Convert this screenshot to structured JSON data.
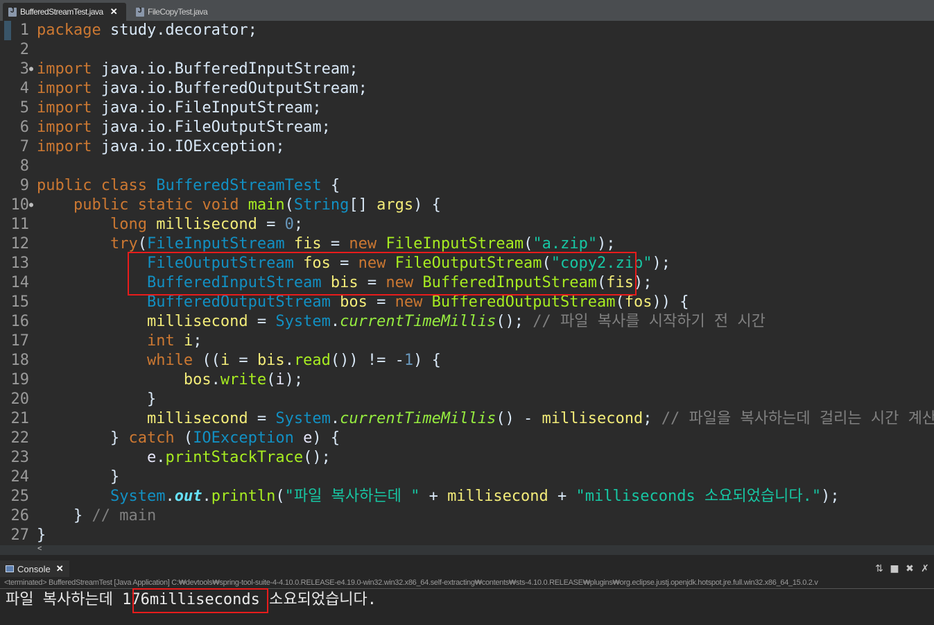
{
  "tabs": [
    {
      "label": "BufferedStreamTest.java",
      "active": true
    },
    {
      "label": "FileCopyTest.java",
      "active": false
    }
  ],
  "lines": [
    {
      "n": "1"
    },
    {
      "n": "2"
    },
    {
      "n": "3"
    },
    {
      "n": "4"
    },
    {
      "n": "5"
    },
    {
      "n": "6"
    },
    {
      "n": "7"
    },
    {
      "n": "8"
    },
    {
      "n": "9"
    },
    {
      "n": "10"
    },
    {
      "n": "11"
    },
    {
      "n": "12"
    },
    {
      "n": "13"
    },
    {
      "n": "14"
    },
    {
      "n": "15"
    },
    {
      "n": "16"
    },
    {
      "n": "17"
    },
    {
      "n": "18"
    },
    {
      "n": "19"
    },
    {
      "n": "20"
    },
    {
      "n": "21"
    },
    {
      "n": "22"
    },
    {
      "n": "23"
    },
    {
      "n": "24"
    },
    {
      "n": "25"
    },
    {
      "n": "26"
    },
    {
      "n": "27"
    }
  ],
  "code": {
    "l1": [
      "package",
      " study.decorator;"
    ],
    "l3": [
      "import",
      " java.io.BufferedInputStream;"
    ],
    "l4": [
      "import",
      " java.io.BufferedOutputStream;"
    ],
    "l5": [
      "import",
      " java.io.FileInputStream;"
    ],
    "l6": [
      "import",
      " java.io.FileOutputStream;"
    ],
    "l7": [
      "import",
      " java.io.IOException;"
    ],
    "l9": [
      "public",
      " class ",
      "BufferedStreamTest",
      " {"
    ],
    "l10": [
      "    ",
      "public",
      " ",
      "static",
      " ",
      "void",
      " ",
      "main",
      "(",
      "String",
      "[] ",
      "args",
      ") {"
    ],
    "l11": [
      "        ",
      "long",
      " ",
      "millisecond",
      " = ",
      "0",
      ";"
    ],
    "l12": [
      "        ",
      "try",
      "(",
      "FileInputStream",
      " ",
      "fis",
      " = ",
      "new",
      " ",
      "FileInputStream",
      "(",
      "\"a.zip\"",
      ");"
    ],
    "l13": [
      "            ",
      "FileOutputStream",
      " ",
      "fos",
      " = ",
      "new",
      " ",
      "FileOutputStream",
      "(",
      "\"copy2.zip\"",
      ");"
    ],
    "l14": [
      "            ",
      "BufferedInputStream",
      " ",
      "bis",
      " = ",
      "new",
      " ",
      "BufferedInputStream",
      "(",
      "fis",
      ");"
    ],
    "l15": [
      "            ",
      "BufferedOutputStream",
      " ",
      "bos",
      " = ",
      "new",
      " ",
      "BufferedOutputStream",
      "(",
      "fos",
      ")) {"
    ],
    "l16": [
      "            ",
      "millisecond",
      " = ",
      "System",
      ".",
      "currentTimeMillis",
      "(); ",
      "// 파일 복사를 시작하기 전 시간"
    ],
    "l17": [
      "            ",
      "int",
      " ",
      "i",
      ";"
    ],
    "l18": [
      "            ",
      "while",
      " ((",
      "i",
      " = ",
      "bis",
      ".",
      "read",
      "()) != -",
      "1",
      ") {"
    ],
    "l19": [
      "                ",
      "bos",
      ".",
      "write",
      "(",
      "i",
      ");"
    ],
    "l20": [
      "            }"
    ],
    "l21": [
      "            ",
      "millisecond",
      " = ",
      "System",
      ".",
      "currentTimeMillis",
      "() - ",
      "millisecond",
      "; ",
      "// 파일을 복사하는데 걸리는 시간 계산"
    ],
    "l22": [
      "        } ",
      "catch",
      " (",
      "IOException",
      " ",
      "e",
      ") {"
    ],
    "l23": [
      "            ",
      "e",
      ".",
      "printStackTrace",
      "();"
    ],
    "l24": [
      "        }"
    ],
    "l25": [
      "        ",
      "System",
      ".",
      "out",
      ".",
      "println",
      "(",
      "\"파일 복사하는데 \"",
      " + ",
      "millisecond",
      " + ",
      "\"milliseconds 소요되었습니다.\"",
      ");"
    ],
    "l26": [
      "    } ",
      "// main"
    ],
    "l27": [
      "}"
    ]
  },
  "console": {
    "tab_label": "Console",
    "terminated": "<terminated> BufferedStreamTest [Java Application] C:₩devtools₩spring-tool-suite-4-4.10.0.RELEASE-e4.19.0-win32.win32.x86_64.self-extracting₩contents₩sts-4.10.0.RELEASE₩plugins₩org.eclipse.justj.openjdk.hotspot.jre.full.win32.x86_64_15.0.2.v",
    "output_before": "파일 복사하는데 ",
    "output_highlight": "176milliseconds",
    "output_after": " 소요되었습니다."
  },
  "colors": {
    "keyword": "#cc7832",
    "type": "#1290c3",
    "string": "#17c6a3",
    "method": "#a7ec21",
    "comment": "#808080",
    "highlight_box": "#e81c1c"
  },
  "icons": [
    "java-file-icon",
    "close-icon",
    "console-icon",
    "pin-icon",
    "stop-icon",
    "remove-icon",
    "remove-all-icon"
  ]
}
